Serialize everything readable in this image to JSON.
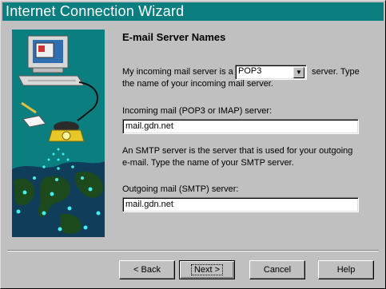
{
  "window": {
    "title": "Internet Connection Wizard"
  },
  "page": {
    "heading": "E-mail Server Names",
    "incoming_type_prefix": "My incoming mail server is a",
    "incoming_type_suffix": "server. Type",
    "incoming_type_line2": "the name of your incoming mail server.",
    "server_type": {
      "selected": "POP3"
    },
    "incoming_label": "Incoming mail (POP3 or IMAP) server:",
    "incoming_value": "mail.gdn.net",
    "smtp_info_line1": "An SMTP server is the server that is used for your outgoing",
    "smtp_info_line2": "e-mail.  Type the name of your SMTP server.",
    "outgoing_label": "Outgoing mail (SMTP) server:",
    "outgoing_value": "mail.gdn.net"
  },
  "buttons": {
    "back": "< Back",
    "next": "Next >",
    "cancel": "Cancel",
    "help": "Help"
  },
  "colors": {
    "titlebar": "#0b7e80",
    "face": "#c0c0c0",
    "art_bg": "#0b7e80",
    "land": "#1c4a1c",
    "points": "#3ff0f0"
  },
  "icons": {
    "illustration": "computer-phone-network-illustration",
    "dropdown": "chevron-down-icon"
  }
}
